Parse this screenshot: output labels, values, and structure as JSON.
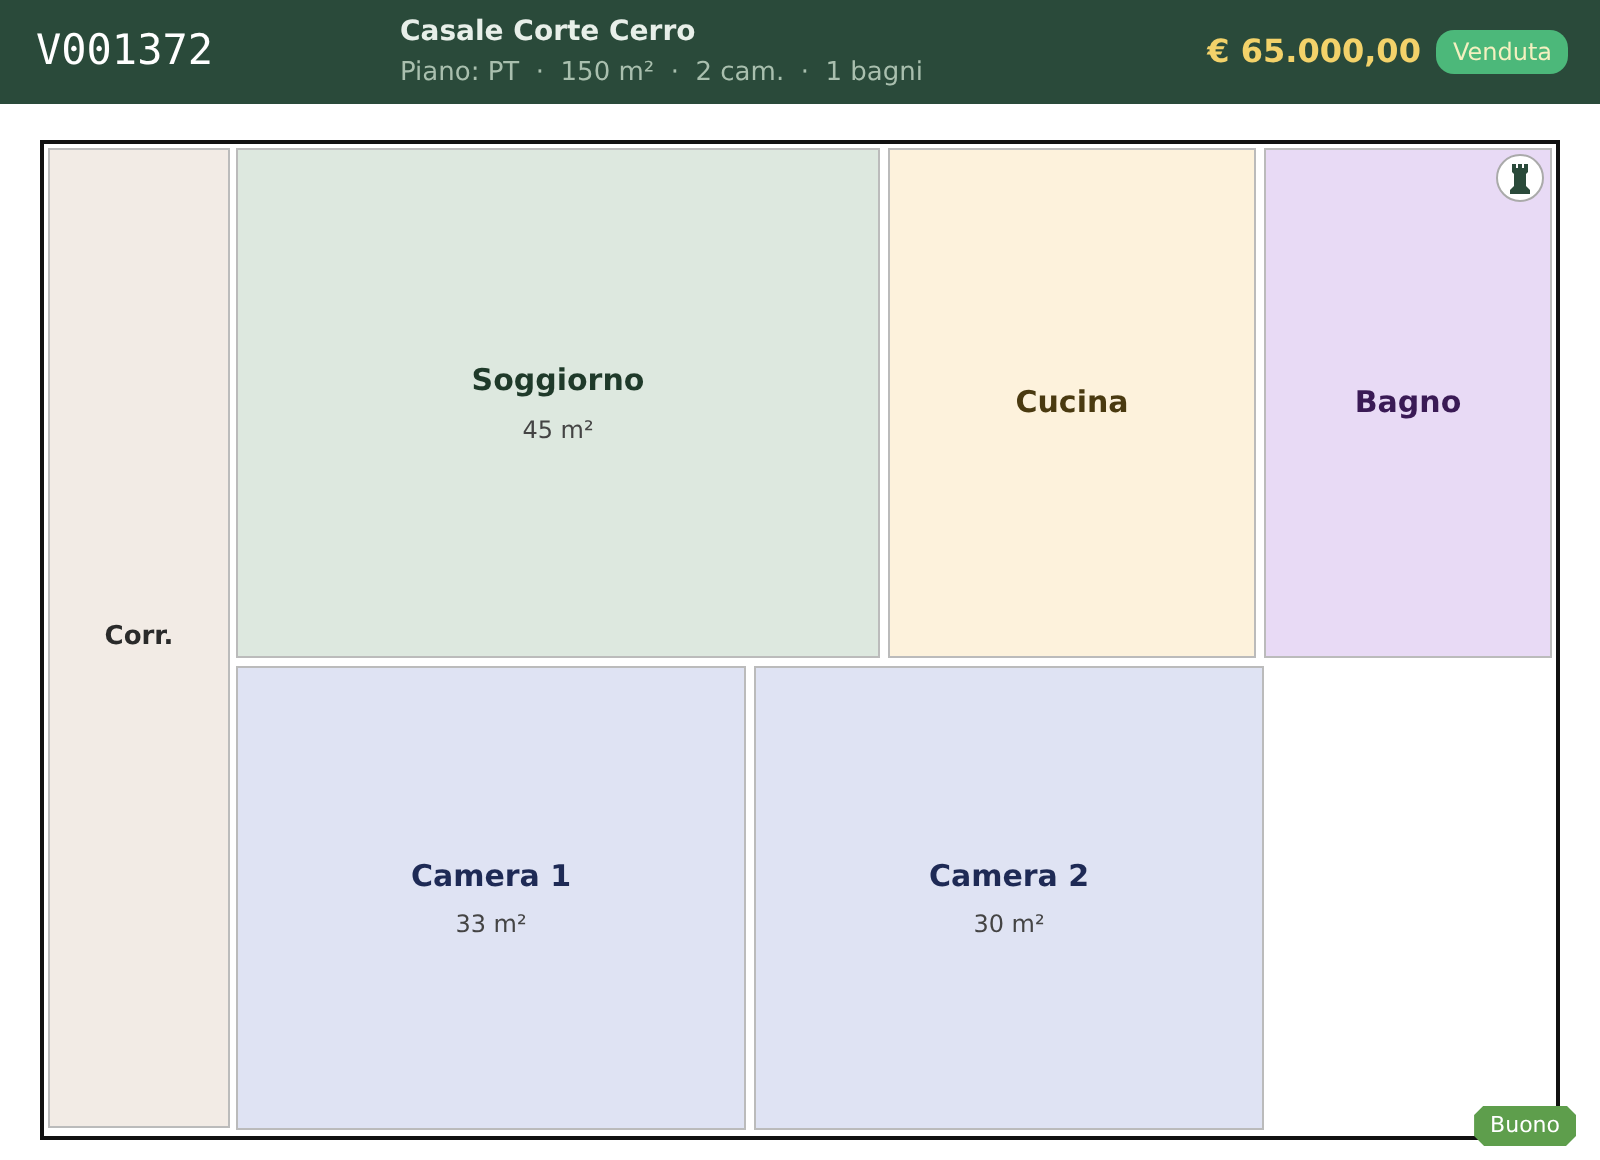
{
  "header": {
    "code": "V001372",
    "title": "Casale Corte Cerro",
    "details": "Piano: PT  ·  150 m²  ·  2 cam.  ·  1 bagni",
    "price": "€ 65.000,00",
    "status": "Venduta"
  },
  "rooms": [
    {
      "kind": "corridor",
      "name": "Corr."
    },
    {
      "kind": "living",
      "name": "Soggiorno",
      "area": "45 m²"
    },
    {
      "kind": "kitchen",
      "name": "Cucina"
    },
    {
      "kind": "bathroom",
      "name": "Bagno"
    },
    {
      "kind": "bedroom",
      "name": "Camera 1",
      "area": "33 m²"
    },
    {
      "kind": "bedroom",
      "name": "Camera 2",
      "area": "30 m²"
    }
  ],
  "condition": "Buono"
}
